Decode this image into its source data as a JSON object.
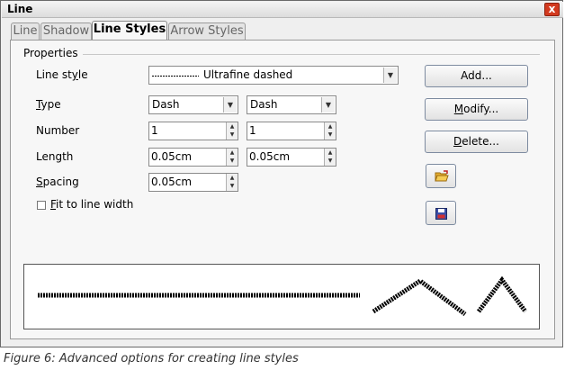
{
  "window": {
    "title": "Line",
    "close_label": "x"
  },
  "tabs": [
    {
      "label": "Line"
    },
    {
      "label": "Shadow"
    },
    {
      "label": "Line Styles"
    },
    {
      "label": "Arrow Styles"
    }
  ],
  "properties": {
    "section_label": "Properties",
    "line_style": {
      "label_pre": "Line st",
      "label_ul": "y",
      "label_post": "le",
      "value": "Ultrafine dashed"
    },
    "type": {
      "label_ul": "T",
      "label_post": "ype",
      "value1": "Dash",
      "value2": "Dash"
    },
    "number": {
      "label": "Number",
      "value1": "1",
      "value2": "1"
    },
    "length": {
      "label": "Length",
      "value1": "0.05cm",
      "value2": "0.05cm"
    },
    "spacing": {
      "label_ul": "S",
      "label_post": "pacing",
      "value": "0.05cm"
    },
    "fit": {
      "label_ul": "F",
      "label_post": "it to line width",
      "checked": false
    }
  },
  "buttons": {
    "add": "Add...",
    "modify_ul": "M",
    "modify_post": "odify...",
    "delete_ul": "D",
    "delete_post": "elete..."
  },
  "icons": {
    "load": "open-folder-icon",
    "save": "save-disk-icon"
  },
  "colors": {
    "close": "#d23a1f",
    "preview_line": "#000000"
  },
  "caption": "Figure 6: Advanced options for creating line styles"
}
